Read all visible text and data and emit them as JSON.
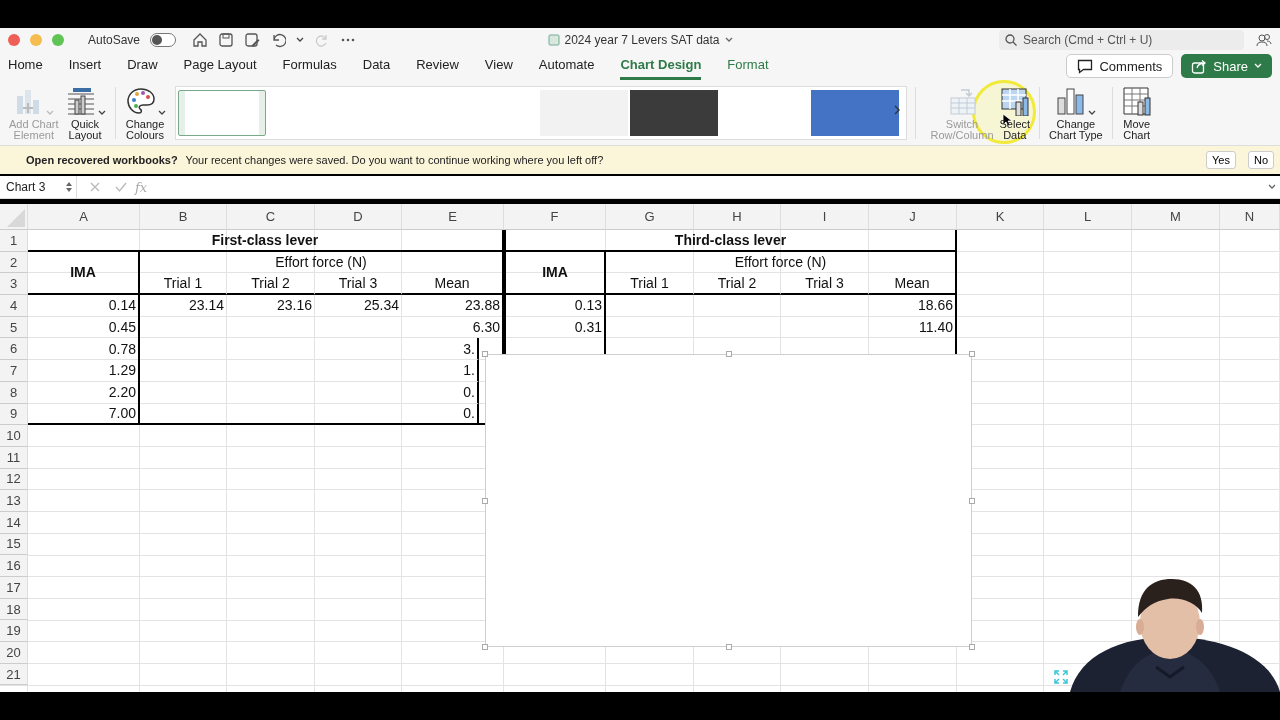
{
  "window": {
    "title": "2024 year 7 Levers SAT data"
  },
  "quick_access": {
    "autosave_label": "AutoSave",
    "autosave_on": false
  },
  "search": {
    "placeholder": "Search (Cmd + Ctrl + U)"
  },
  "tabs": [
    {
      "label": "Home",
      "selected": false,
      "kind": "standard"
    },
    {
      "label": "Insert",
      "selected": false,
      "kind": "standard"
    },
    {
      "label": "Draw",
      "selected": false,
      "kind": "standard"
    },
    {
      "label": "Page Layout",
      "selected": false,
      "kind": "standard"
    },
    {
      "label": "Formulas",
      "selected": false,
      "kind": "standard"
    },
    {
      "label": "Data",
      "selected": false,
      "kind": "standard"
    },
    {
      "label": "Review",
      "selected": false,
      "kind": "standard"
    },
    {
      "label": "View",
      "selected": false,
      "kind": "standard"
    },
    {
      "label": "Automate",
      "selected": false,
      "kind": "standard"
    },
    {
      "label": "Chart Design",
      "selected": true,
      "kind": "contextual"
    },
    {
      "label": "Format",
      "selected": false,
      "kind": "contextual"
    }
  ],
  "comments_button": "Comments",
  "share_button": "Share",
  "ribbon": {
    "left": [
      {
        "lines": [
          "Add Chart",
          "Element"
        ],
        "disabled": true,
        "dropdown": true,
        "kind": "add-element"
      },
      {
        "lines": [
          "Quick",
          "Layout"
        ],
        "disabled": false,
        "dropdown": true,
        "kind": "layout"
      },
      {
        "lines": [
          "Change",
          "Colours"
        ],
        "disabled": false,
        "dropdown": true,
        "kind": "colours"
      }
    ],
    "chart_styles": [
      {
        "color": "#ffffff",
        "selected": true
      },
      {
        "color": "#f2f2f2",
        "selected": false
      },
      {
        "color": "#3b3b3b",
        "selected": false
      },
      {
        "color": "#4472c4",
        "selected": false
      }
    ],
    "right": [
      {
        "lines": [
          "Switch",
          "Row/Column"
        ],
        "disabled": true,
        "dropdown": false,
        "kind": "switch"
      },
      {
        "lines": [
          "Select",
          "Data"
        ],
        "disabled": false,
        "dropdown": false,
        "kind": "select-data"
      },
      {
        "lines": [
          "Change",
          "Chart Type"
        ],
        "disabled": false,
        "dropdown": true,
        "kind": "chart-type"
      },
      {
        "lines": [
          "Move",
          "Chart"
        ],
        "disabled": false,
        "dropdown": false,
        "kind": "move"
      }
    ]
  },
  "notice": {
    "title": "Open recovered workbooks?",
    "message": "Your recent changes were saved. Do you want to continue working where you left off?",
    "buttons": [
      "Yes",
      "No"
    ]
  },
  "formula_bar": {
    "name_box": "Chart 3",
    "function_label": "fx"
  },
  "sheet": {
    "columns": [
      "A",
      "B",
      "C",
      "D",
      "E",
      "F",
      "G",
      "H",
      "I",
      "J",
      "K",
      "L",
      "M",
      "N"
    ],
    "row_numbers": [
      "1",
      "2",
      "3",
      "4",
      "5",
      "6",
      "7",
      "8",
      "9",
      "10",
      "11",
      "12",
      "13",
      "14",
      "15",
      "16",
      "17",
      "18",
      "19",
      "20",
      "21"
    ],
    "tables": [
      {
        "title": "First-class lever",
        "ima_header": "IMA",
        "group_header": "Effort force (N)",
        "columns": [
          "Trial 1",
          "Trial 2",
          "Trial 3",
          "Mean"
        ],
        "rows": [
          {
            "ima": "0.14",
            "trials": [
              "23.14",
              "23.16",
              "25.34"
            ],
            "mean": "23.88"
          },
          {
            "ima": "0.45",
            "mean": "6.30"
          },
          {
            "ima": "0.78",
            "mean": "3."
          },
          {
            "ima": "1.29",
            "mean": "1."
          },
          {
            "ima": "2.20",
            "mean": "0."
          },
          {
            "ima": "7.00",
            "mean": "0."
          }
        ]
      },
      {
        "title": "Third-class lever",
        "ima_header": "IMA",
        "group_header": "Effort force (N)",
        "columns": [
          "Trial 1",
          "Trial 2",
          "Trial 3",
          "Mean"
        ],
        "rows": [
          {
            "ima": "0.13",
            "mean": "18.66"
          },
          {
            "ima": "0.31",
            "mean": "11.40"
          }
        ]
      }
    ]
  }
}
